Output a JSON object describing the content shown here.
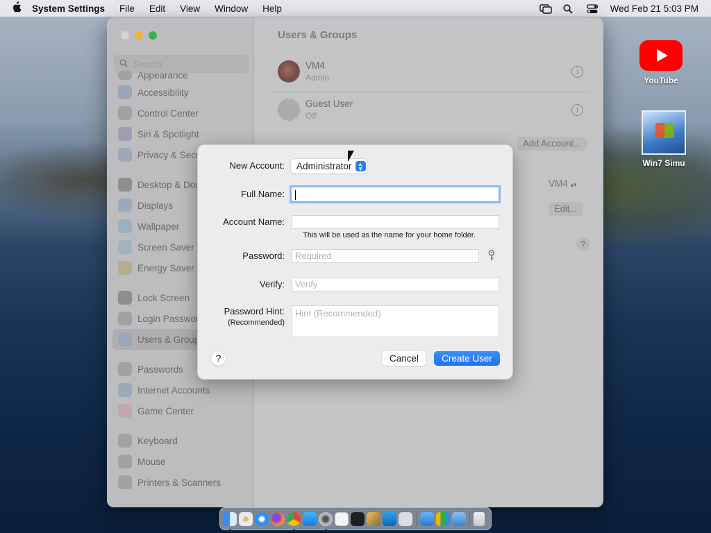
{
  "menubar": {
    "app_name": "System Settings",
    "menus": [
      "File",
      "Edit",
      "View",
      "Window",
      "Help"
    ],
    "clock": "Wed Feb 21  5:03 PM"
  },
  "desktop": {
    "icons": [
      {
        "label": "YouTube"
      },
      {
        "label": "Win7 Simu"
      }
    ]
  },
  "window": {
    "title": "Users & Groups",
    "search_placeholder": "Search",
    "sidebar_items": [
      "Appearance",
      "Accessibility",
      "Control Center",
      "Siri & Spotlight",
      "Privacy & Secu",
      "Desktop & Doc",
      "Displays",
      "Wallpaper",
      "Screen Saver",
      "Energy Saver",
      "Lock Screen",
      "Login Passwor",
      "Users & Group",
      "Passwords",
      "Internet Accounts",
      "Game Center",
      "Keyboard",
      "Mouse",
      "Printers & Scanners"
    ],
    "users": [
      {
        "name": "VM4",
        "role": "Admin"
      },
      {
        "name": "Guest User",
        "role": "Off"
      }
    ],
    "add_account_label": "Add Account...",
    "autologin_value": "VM4",
    "edit_label": "Edit...",
    "help_label": "?"
  },
  "dialog": {
    "new_account_label": "New Account:",
    "account_type": "Administrator",
    "full_name_label": "Full Name:",
    "full_name_value": "",
    "account_name_label": "Account Name:",
    "account_name_value": "",
    "account_name_note": "This will be used as the name for your home folder.",
    "password_label": "Password:",
    "password_placeholder": "Required",
    "verify_label": "Verify:",
    "verify_placeholder": "Verify",
    "hint_label": "Password Hint:",
    "hint_sublabel": "(Recommended)",
    "hint_placeholder": "Hint (Recommended)",
    "help_label": "?",
    "cancel_label": "Cancel",
    "create_label": "Create User"
  },
  "dock": {
    "apps": [
      "finder",
      "launchpad",
      "safari",
      "firefox",
      "chrome",
      "app-store",
      "system-settings",
      "textedit",
      "terminal",
      "script-editor",
      "vscode",
      "preview",
      "files",
      "numbers",
      "preview-2",
      "trash"
    ]
  }
}
